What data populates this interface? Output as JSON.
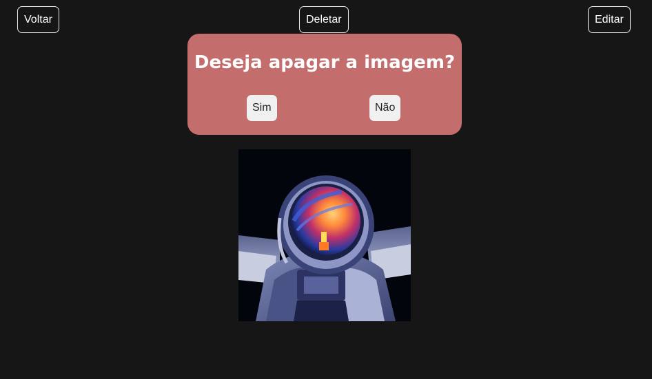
{
  "toolbar": {
    "back_label": "Voltar",
    "delete_label": "Deletar",
    "edit_label": "Editar"
  },
  "confirm_dialog": {
    "title": "Deseja apagar a imagem?",
    "yes_label": "Sim",
    "no_label": "Não"
  },
  "image": {
    "subject": "astronaut-illustration"
  },
  "colors": {
    "background": "#161616",
    "dialog": "#c46d6d",
    "button_light": "#f0f0f0"
  }
}
